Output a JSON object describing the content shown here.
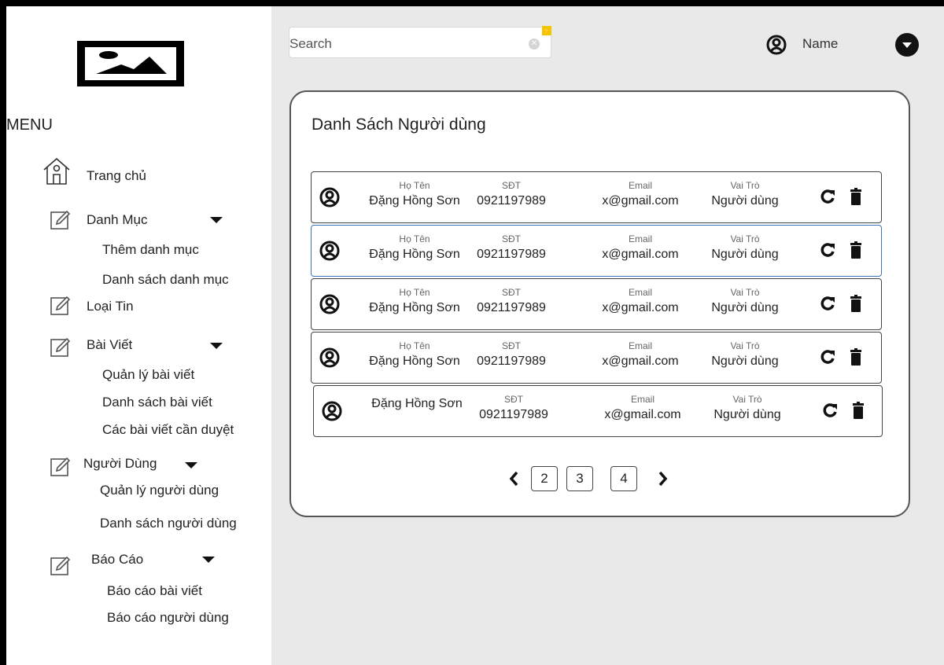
{
  "search": {
    "placeholder": "Search"
  },
  "user": {
    "name": "Name"
  },
  "sidebar": {
    "menu_title": "MENU",
    "home": "Trang chủ",
    "categories": {
      "label": "Danh Mục",
      "sub": [
        "Thêm danh mục",
        "Danh sách danh mục"
      ]
    },
    "news_type": "Loại Tin",
    "posts": {
      "label": "Bài Viết",
      "sub": [
        "Quản lý bài viết",
        "Danh sách bài viết",
        "Các bài viết cần duyệt"
      ]
    },
    "users": {
      "label": "Người Dùng",
      "sub": [
        "Quản lý người dùng",
        "Danh sách người dùng"
      ]
    },
    "reports": {
      "label": "Báo Cáo",
      "sub": [
        "Báo cáo bài viết",
        "Báo cáo người dùng"
      ]
    }
  },
  "panel": {
    "title": "Danh Sách Người dùng",
    "headers": {
      "name": "Họ Tên",
      "phone": "SĐT",
      "email": "Email",
      "role": "Vai Trò"
    },
    "rows": [
      {
        "name": "Đặng Hồng Sơn",
        "phone": "0921197989",
        "email": "x@gmail.com",
        "role": "Người dùng",
        "show_name_label": true
      },
      {
        "name": "Đặng Hồng Sơn",
        "phone": "0921197989",
        "email": "x@gmail.com",
        "role": "Người dùng",
        "show_name_label": true
      },
      {
        "name": "Đặng Hồng Sơn",
        "phone": "0921197989",
        "email": "x@gmail.com",
        "role": "Người dùng",
        "show_name_label": true
      },
      {
        "name": "Đặng Hồng Sơn",
        "phone": "0921197989",
        "email": "x@gmail.com",
        "role": "Người dùng",
        "show_name_label": true
      },
      {
        "name": "Đặng Hồng Sơn",
        "phone": "0921197989",
        "email": "x@gmail.com",
        "role": "Người dùng",
        "show_name_label": false
      }
    ]
  },
  "pagination": {
    "pages": [
      "2",
      "3",
      "4"
    ]
  },
  "colors": {
    "accent": "#3d74b8",
    "background": "#e9e9e9",
    "sidebar": "#ffffff"
  }
}
